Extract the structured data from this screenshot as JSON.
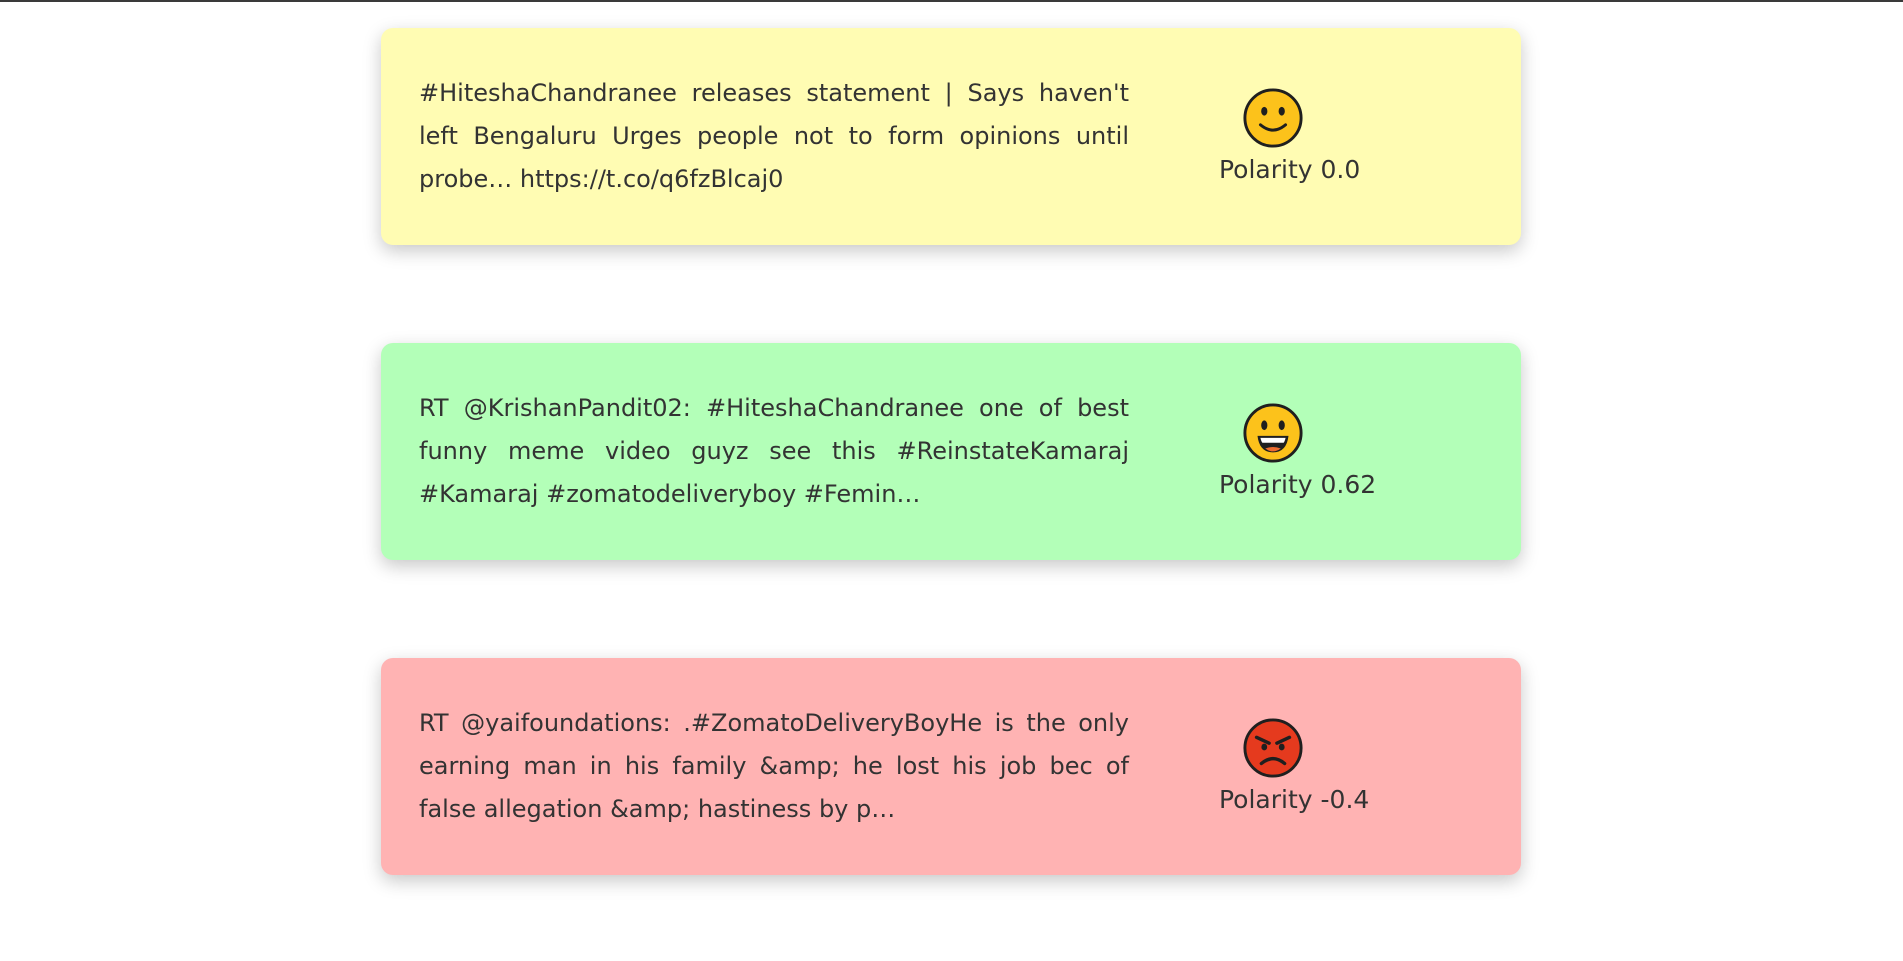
{
  "tweets": [
    {
      "sentiment": "neutral",
      "background_color": "#fffcb3",
      "icon": "slightly-smiling-face-icon",
      "text": "#HiteshaChandranee releases statement | Says haven't left Bengaluru Urges people not to form opinions until probe… https://t.co/q6fzBlcaj0",
      "polarity_label": "Polarity 0.0"
    },
    {
      "sentiment": "positive",
      "background_color": "#b3ffb8",
      "icon": "grinning-face-icon",
      "text": "RT @KrishanPandit02: #HiteshaChandranee one of best funny meme video guyz see this #ReinstateKamaraj #Kamaraj #zomatodeliveryboy #Femin…",
      "polarity_label": "Polarity 0.62"
    },
    {
      "sentiment": "negative",
      "background_color": "#ffb3b3",
      "icon": "angry-face-icon",
      "text": "RT @yaifoundations: .#ZomatoDeliveryBoyHe is the only earning man in his family &amp; he lost his job bec of false allegation &amp; hastiness by p…",
      "polarity_label": "Polarity -0.4"
    }
  ]
}
